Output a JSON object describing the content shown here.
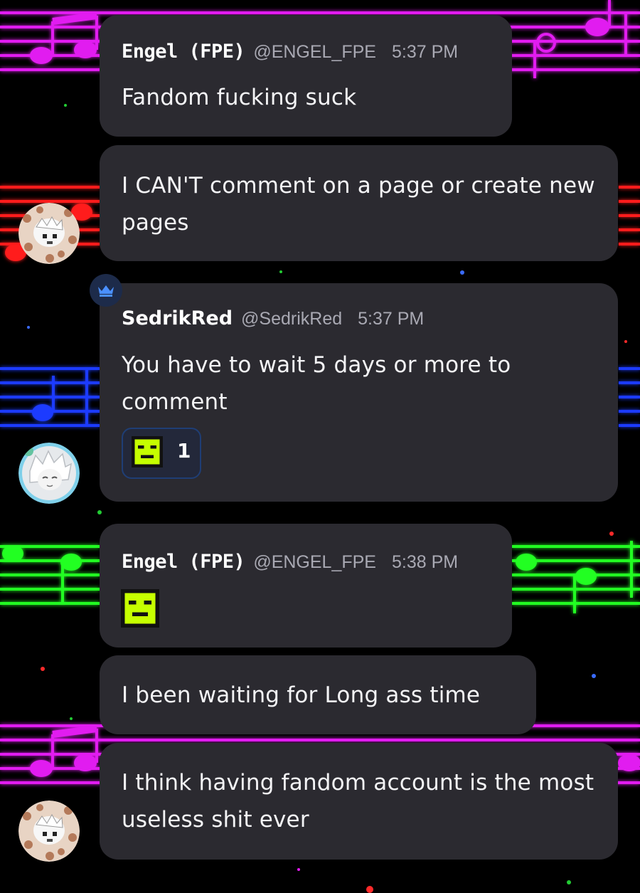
{
  "messages": [
    {
      "author": "Engel (FPE)",
      "handle": "@ENGEL_FPE",
      "time": "5:37 PM",
      "text": "Fandom fucking suck"
    },
    {
      "text": "I CAN'T comment on a page or create new pages"
    },
    {
      "author": "SedrikRed",
      "handle": "@SedrikRed",
      "time": "5:37 PM",
      "text": "You have to wait 5 days or more to comment",
      "reaction_emoji": "green-pixel-face-emoji",
      "reaction_count": "1"
    },
    {
      "author": "Engel (FPE)",
      "handle": "@ENGEL_FPE",
      "time": "5:38 PM",
      "emoji": "green-pixel-face-emoji"
    },
    {
      "text": "I been waiting for Long ass time"
    },
    {
      "text": "I think having fandom account is the most useless shit ever"
    }
  ],
  "icons": {
    "crown": "crown-icon",
    "avatar_engel": "avatar-engel",
    "avatar_sedrik": "avatar-sedrikred"
  },
  "colors": {
    "bubble": "#2b2a30",
    "background": "#000000",
    "staff_magenta": "#e11cf0",
    "staff_red": "#ff1a1a",
    "staff_blue": "#1a3bff",
    "staff_green": "#22ff22",
    "emoji_green": "#c6ff00",
    "crown_blue": "#4a90ff"
  }
}
